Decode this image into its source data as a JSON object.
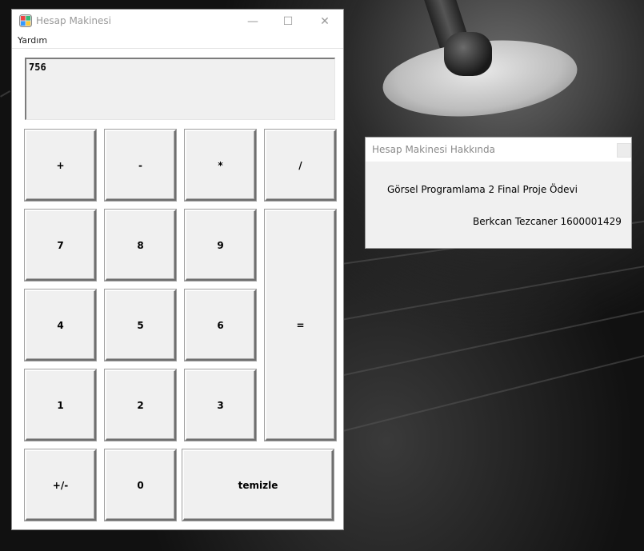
{
  "window": {
    "title": "Hesap Makinesi",
    "minimize": "—",
    "maximize": "☐",
    "close": "✕",
    "icon": "calculator-app-icon"
  },
  "menu": {
    "help": "Yardım"
  },
  "display": {
    "value": "756"
  },
  "buttons": {
    "plus": "+",
    "minus": "-",
    "multiply": "*",
    "divide": "/",
    "seven": "7",
    "eight": "8",
    "nine": "9",
    "equals": "=",
    "four": "4",
    "five": "5",
    "six": "6",
    "one": "1",
    "two": "2",
    "three": "3",
    "sign": "+/-",
    "zero": "0",
    "clear": "temizle"
  },
  "about": {
    "title": "Hesap Makinesi Hakkında",
    "line1": "Görsel Programlama 2 Final Proje Ödevi",
    "line2": "Berkcan  Tezcaner 1600001429"
  }
}
